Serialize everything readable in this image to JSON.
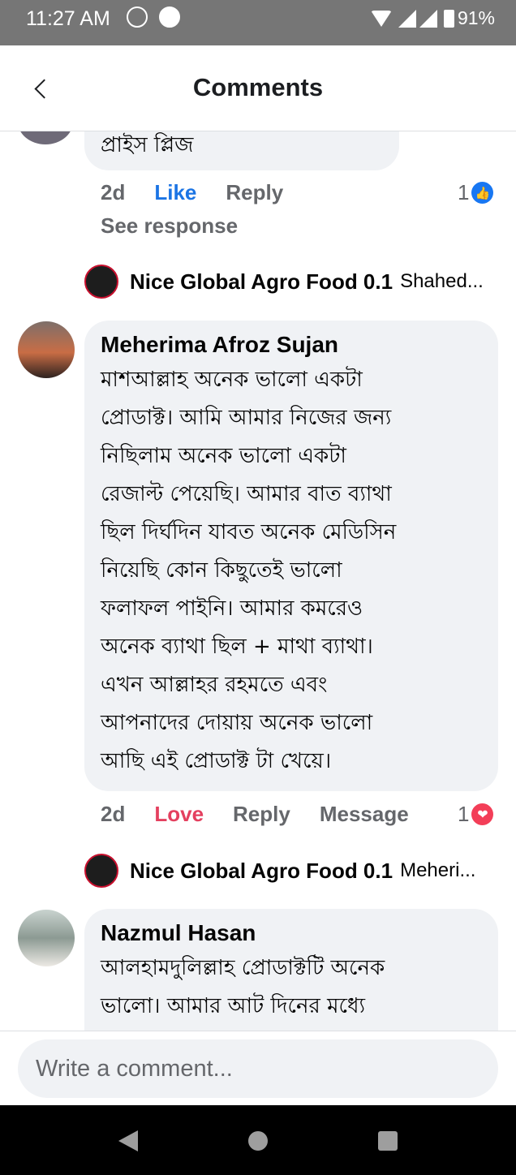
{
  "status_bar": {
    "time": "11:27 AM",
    "battery": "91%"
  },
  "header": {
    "title": "Comments"
  },
  "comments": [
    {
      "text": "প্রাইস প্লিজ",
      "time": "2d",
      "reaction_label": "Like",
      "reply_label": "Reply",
      "reaction_count": "1",
      "see_response": "See response",
      "reply_preview": {
        "name": "Nice Global Agro Food 0.1",
        "snippet": "Shahed..."
      }
    },
    {
      "author": "Meherima Afroz Sujan",
      "lines": [
        "মাশআল্লাহ অনেক ভালো একটা",
        "প্রোডাক্ট। আমি আমার নিজের জন্য",
        "নিছিলাম অনেক ভালো একটা",
        "রেজাল্ট পেয়েছি।  আমার বাত ব্যাথা",
        "ছিল দির্ঘদিন যাবত অনেক মেডিসিন",
        "নিয়েছি কোন কিছুতেই ভালো",
        "ফলাফল পাইনি। আমার কমরেও",
        "অনেক ব্যাথা ছিল + মাথা ব্যাথা।",
        "এখন আল্লাহর  রহমতে এবং",
        "আপনাদের দোয়ায় অনেক ভালো",
        "আছি এই প্রোডাক্ট টা খেয়ে।"
      ],
      "time": "2d",
      "reaction_label": "Love",
      "reply_label": "Reply",
      "message_label": "Message",
      "reaction_count": "1",
      "reply_preview": {
        "name": "Nice Global Agro Food 0.1",
        "snippet": "Meheri..."
      }
    },
    {
      "author": "Nazmul Hasan",
      "lines": [
        "আলহামদুলিল্লাহ প্রোডাক্টটি অনেক",
        "ভালো। আমার  আট দিনের মধ্যে"
      ]
    }
  ],
  "composer": {
    "placeholder": "Write a comment..."
  }
}
